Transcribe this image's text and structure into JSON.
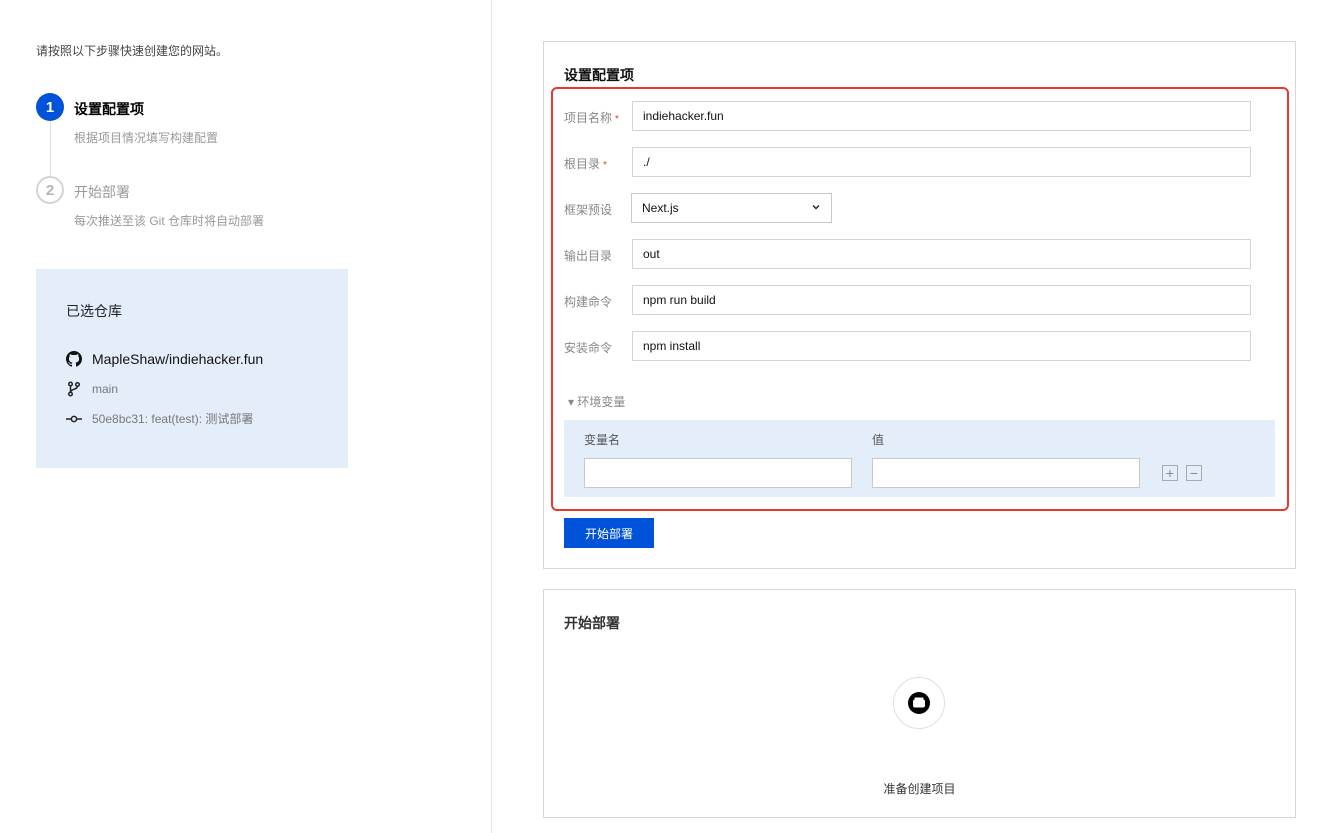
{
  "intro": "请按照以下步骤快速创建您的网站。",
  "steps": [
    {
      "number": "1",
      "title": "设置配置项",
      "desc": "根据项目情况填写构建配置",
      "state": "active"
    },
    {
      "number": "2",
      "title": "开始部署",
      "desc": "每次推送至该 Git 仓库时将自动部署",
      "state": "pending"
    }
  ],
  "repo": {
    "title": "已选仓库",
    "name": "MapleShaw/indiehacker.fun",
    "branch": "main",
    "commit": "50e8bc31: feat(test): 测试部署",
    "icons": {
      "repo": "github-icon",
      "branch": "git-branch-icon",
      "commit": "git-commit-icon"
    }
  },
  "config": {
    "title": "设置配置项",
    "required_mark": "*",
    "fields": {
      "project_name": {
        "label": "项目名称",
        "value": "indiehacker.fun",
        "required": true
      },
      "root_dir": {
        "label": "根目录",
        "value": "./",
        "required": true
      },
      "framework": {
        "label": "框架预设",
        "value": "Next.js"
      },
      "output_dir": {
        "label": "输出目录",
        "value": "out"
      },
      "build_cmd": {
        "label": "构建命令",
        "value": "npm run build"
      },
      "install_cmd": {
        "label": "安装命令",
        "value": "npm install"
      }
    },
    "env": {
      "toggle": "▾ 环境变量",
      "name_header": "变量名",
      "value_header": "值",
      "name_value": "",
      "value_value": "",
      "add": "+",
      "remove": "−"
    },
    "deploy_button": "开始部署"
  },
  "deploy": {
    "title": "开始部署",
    "status": "准备创建项目"
  },
  "colors": {
    "accent": "#0052d9",
    "highlight": "#e5392b",
    "panel": "#e4eefb"
  }
}
